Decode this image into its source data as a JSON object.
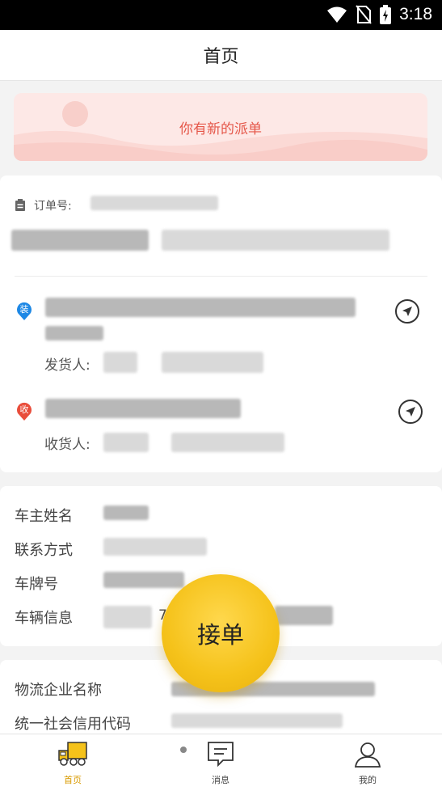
{
  "status_bar": {
    "time": "3:18"
  },
  "header": {
    "title": "首页"
  },
  "banner": {
    "text": "你有新的派单"
  },
  "order": {
    "order_no_label": "订单号:",
    "load_badge": "装",
    "unload_badge": "收",
    "shipper_label": "发货人:",
    "receiver_label": "收货人:"
  },
  "owner": {
    "name_label": "车主姓名",
    "contact_label": "联系方式",
    "plate_label": "车牌号",
    "vehicle_label": "车辆信息",
    "vehicle_partial": "7"
  },
  "company": {
    "name_label": "物流企业名称",
    "credit_label": "统一社会信用代码"
  },
  "accept_button": {
    "label": "接单"
  },
  "bottom_nav": {
    "items": [
      {
        "label": "首页",
        "icon": "truck-icon",
        "active": true
      },
      {
        "label": "消息",
        "icon": "message-icon",
        "active": false
      },
      {
        "label": "我的",
        "icon": "user-icon",
        "active": false
      }
    ]
  },
  "colors": {
    "accent": "#f5c21a",
    "banner_text": "#e5574a",
    "load_badge": "#1e88e5",
    "unload_badge": "#e94e3c"
  }
}
